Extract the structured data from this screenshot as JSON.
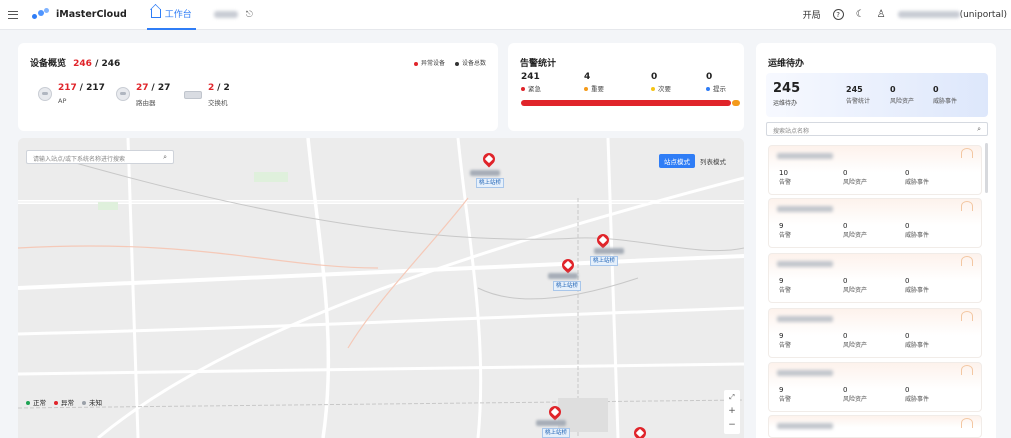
{
  "topbar": {
    "brand": "iMasterCloud",
    "tab_label": "工作台",
    "right": {
      "open_label": "开局",
      "user_suffix": "(uniportal)"
    }
  },
  "overview": {
    "title": "设备概览",
    "count": "246",
    "total": "/ 246",
    "legend": [
      "异常设备",
      "设备总数"
    ],
    "devices": [
      {
        "online": "217",
        "total": "/ 217",
        "label": "AP"
      },
      {
        "online": "27",
        "total": "/ 27",
        "label": "路由器"
      },
      {
        "online": "2",
        "total": "/ 2",
        "label": "交换机"
      }
    ]
  },
  "alarms": {
    "title": "告警统计",
    "items": [
      {
        "value": "241",
        "label": "紧急",
        "color": "#e0242a"
      },
      {
        "value": "4",
        "label": "重要",
        "color": "#f49a1a"
      },
      {
        "value": "0",
        "label": "次要",
        "color": "#f5c518"
      },
      {
        "value": "0",
        "label": "提示",
        "color": "#2f7df6"
      }
    ]
  },
  "map": {
    "search_placeholder": "请输入站点/或下系统名称进行搜索",
    "mode_site": "站点模式",
    "mode_list": "列表模式",
    "legend": [
      {
        "label": "正常",
        "color": "#1ea353"
      },
      {
        "label": "异常",
        "color": "#e0242a"
      },
      {
        "label": "未知",
        "color": "#9aa0a8"
      }
    ],
    "zoom_in": "+",
    "zoom_out": "−",
    "stations": [
      "桃上站桥",
      "桃上站桥",
      "桃上站桥",
      "桃上站桥",
      "桃上站桥"
    ]
  },
  "ops": {
    "title": "运维待办",
    "summary": {
      "big_value": "245",
      "big_label": "运维待办",
      "items": [
        {
          "value": "245",
          "label": "告警统计"
        },
        {
          "value": "0",
          "label": "风险资产"
        },
        {
          "value": "0",
          "label": "威胁事件"
        }
      ]
    },
    "search_placeholder": "搜索站点名称",
    "sites": [
      {
        "alarms": "10",
        "risk": "0",
        "threat": "0"
      },
      {
        "alarms": "9",
        "risk": "0",
        "threat": "0"
      },
      {
        "alarms": "9",
        "risk": "0",
        "threat": "0"
      },
      {
        "alarms": "9",
        "risk": "0",
        "threat": "0"
      },
      {
        "alarms": "9",
        "risk": "0",
        "threat": "0"
      }
    ],
    "col_labels": {
      "alarms": "告警",
      "risk": "风险资产",
      "threat": "威胁事件"
    }
  }
}
